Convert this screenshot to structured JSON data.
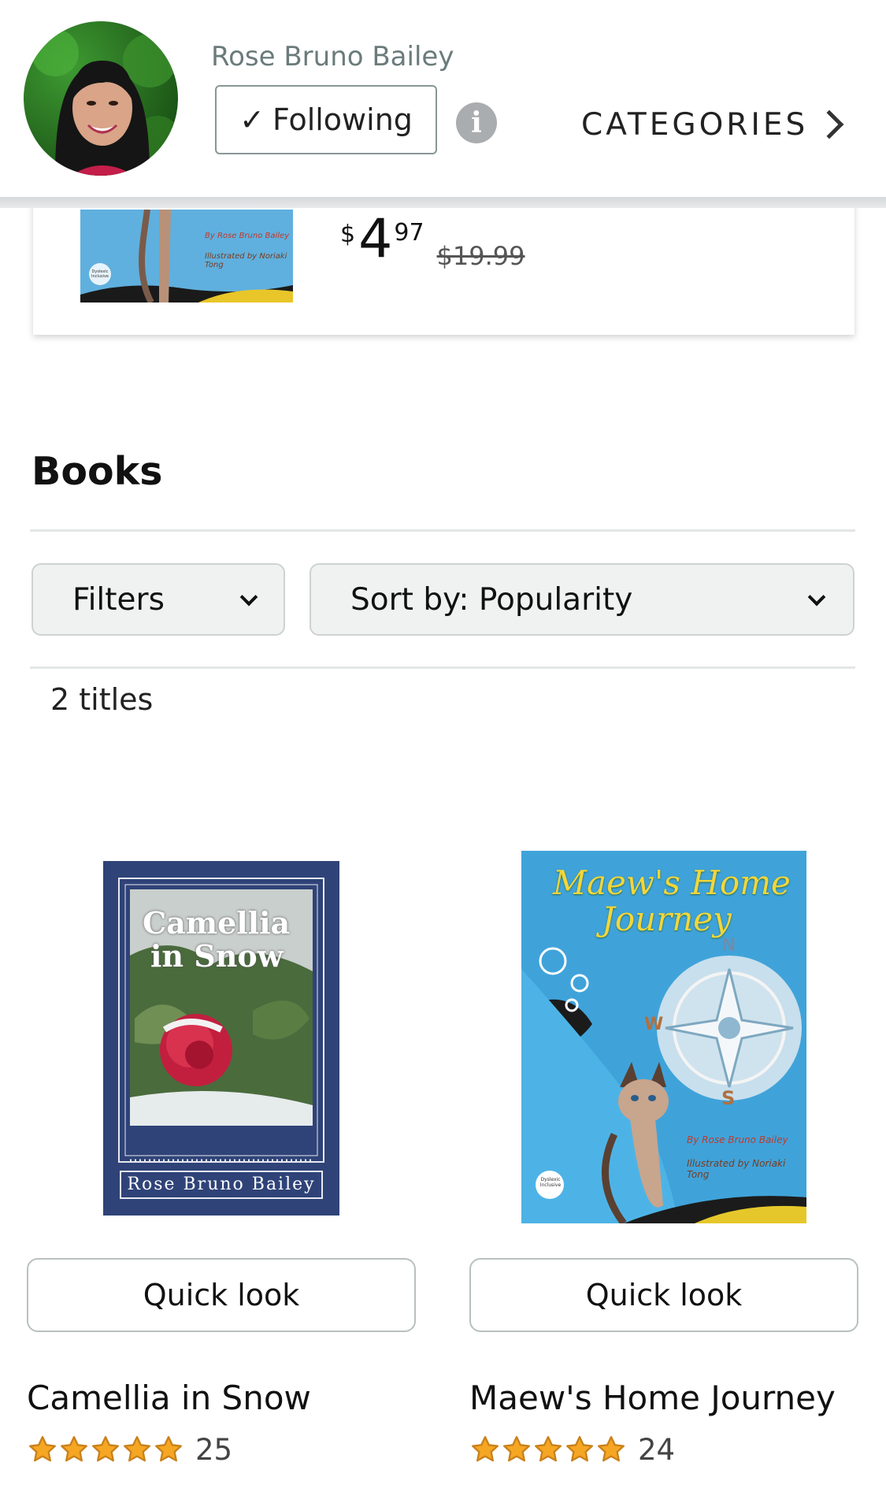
{
  "header": {
    "author_name": "Rose Bruno Bailey",
    "follow_check": "✓",
    "follow_label": "Following",
    "info_glyph": "i",
    "categories_label": "CATEGORIES",
    "icons": [
      "avatar",
      "info-icon",
      "chevron-right-icon"
    ]
  },
  "deal": {
    "price_symbol": "$",
    "price_whole": "4",
    "price_fraction": "97",
    "list_price": "$19.99",
    "cover_text_line1": "By Rose Bruno Bailey",
    "cover_text_line2": "Illustrated by Noriaki Tong",
    "badge": "Dyslexic Inclusive"
  },
  "books_section": {
    "title": "Books",
    "filters_label": "Filters",
    "sort_label": "Sort by: Popularity",
    "title_count": "2 titles"
  },
  "books": [
    {
      "title": "Camellia in Snow",
      "cover_title_line1": "Camellia",
      "cover_title_line2": "in Snow",
      "cover_author": "Rose Bruno Bailey",
      "quick_look": "Quick look",
      "stars": 5,
      "rating_count": "25"
    },
    {
      "title": "Maew's Home Journey",
      "cover_title_line1": "Maew's Home",
      "cover_title_line2": "Journey",
      "cover_author": "By Rose Bruno Bailey",
      "cover_illustrator": "Illustrated by Noriaki Tong",
      "compass": [
        "N",
        "W",
        "S"
      ],
      "badge": "Dyslexic Inclusive",
      "quick_look": "Quick look",
      "stars": 5,
      "rating_count": "24"
    }
  ],
  "colors": {
    "star": "#f5a623",
    "star_stroke": "#c9811a",
    "muted_text": "#6b7b7b",
    "dropdown_bg": "#f0f2f2"
  }
}
